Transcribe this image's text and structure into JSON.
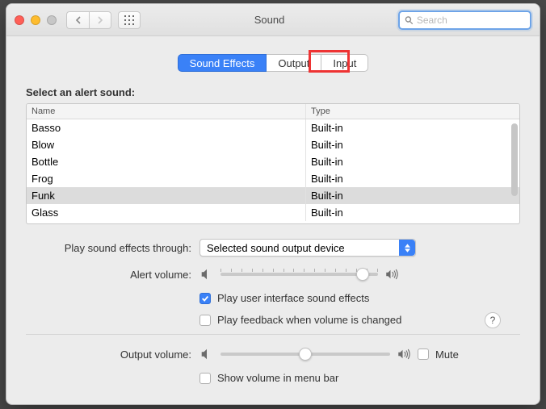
{
  "window_title": "Sound",
  "search": {
    "placeholder": "Search"
  },
  "tabs": {
    "sound_effects": "Sound Effects",
    "output": "Output",
    "input": "Input"
  },
  "section_heading": "Select an alert sound:",
  "table": {
    "header_name": "Name",
    "header_type": "Type",
    "rows": [
      {
        "name": "Basso",
        "type": "Built-in"
      },
      {
        "name": "Blow",
        "type": "Built-in"
      },
      {
        "name": "Bottle",
        "type": "Built-in"
      },
      {
        "name": "Frog",
        "type": "Built-in"
      },
      {
        "name": "Funk",
        "type": "Built-in"
      },
      {
        "name": "Glass",
        "type": "Built-in"
      }
    ],
    "selected_index": 4
  },
  "play_through_label": "Play sound effects through:",
  "play_through_value": "Selected sound output device",
  "alert_volume_label": "Alert volume:",
  "alert_volume_percent": 90,
  "play_ui_fx_label": "Play user interface sound effects",
  "play_ui_fx_checked": true,
  "play_feedback_label": "Play feedback when volume is changed",
  "play_feedback_checked": false,
  "output_volume_label": "Output volume:",
  "output_volume_percent": 50,
  "mute_label": "Mute",
  "mute_checked": false,
  "menubar_label": "Show volume in menu bar",
  "menubar_checked": false,
  "help_label": "?"
}
